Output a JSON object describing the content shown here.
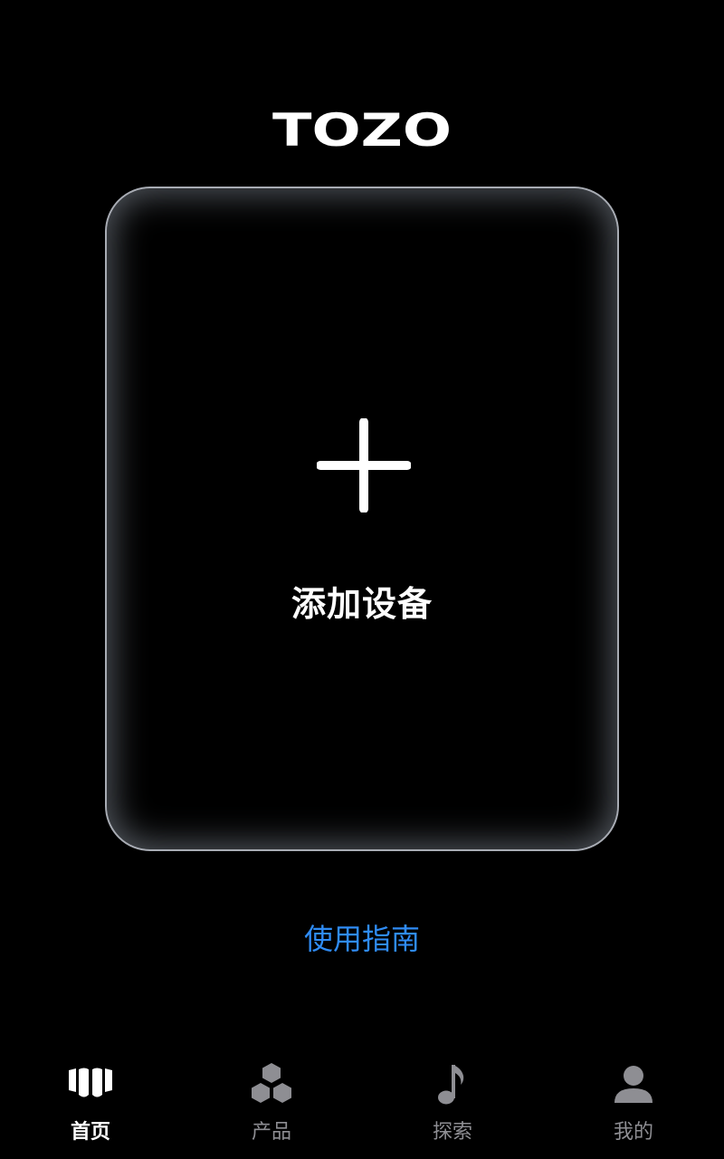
{
  "header": {
    "logo_text": "TOZO"
  },
  "device_card": {
    "add_icon": "plus-icon",
    "add_label": "添加设备"
  },
  "guide": {
    "label": "使用指南",
    "color": "#2f8cf5"
  },
  "tabbar": {
    "active_index": 0,
    "items": [
      {
        "label": "首页",
        "icon": "home-icon",
        "active": true
      },
      {
        "label": "产品",
        "icon": "products-icon",
        "active": false
      },
      {
        "label": "探索",
        "icon": "music-note-icon",
        "active": false
      },
      {
        "label": "我的",
        "icon": "profile-icon",
        "active": false
      }
    ]
  },
  "colors": {
    "background": "#000000",
    "active_tab": "#ffffff",
    "inactive_tab": "#8e8e93",
    "card_border": "#a8acb4"
  }
}
